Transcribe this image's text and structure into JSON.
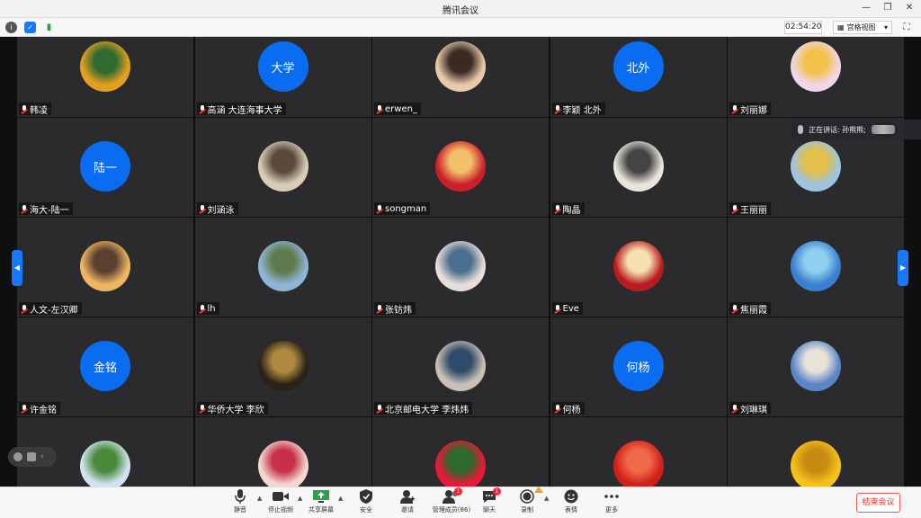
{
  "window": {
    "title": "腾讯会议"
  },
  "statusbar": {
    "timer": "02:54:20",
    "view_mode": "宫格视图"
  },
  "speaking": {
    "label": "正在讲话: 孙熊熊;"
  },
  "participants": [
    {
      "name": "韩凌",
      "avatar_type": "photo",
      "avatar_colors": [
        "#e3a020",
        "#2f6a2f"
      ]
    },
    {
      "name": "高涵 大连海事大学",
      "avatar_type": "text",
      "avatar_text": "大学"
    },
    {
      "name": "erwen_",
      "avatar_type": "photo",
      "avatar_colors": [
        "#e8c9a9",
        "#3a2a22"
      ]
    },
    {
      "name": "李颖 北外",
      "avatar_type": "text",
      "avatar_text": "北外"
    },
    {
      "name": "刘丽娜",
      "avatar_type": "photo",
      "avatar_colors": [
        "#f0d6e8",
        "#f2c14a"
      ]
    },
    {
      "name": "海大-陆一",
      "avatar_type": "text",
      "avatar_text": "陆一"
    },
    {
      "name": "刘涵泳",
      "avatar_type": "photo",
      "avatar_colors": [
        "#d9cdb8",
        "#5a4a3a"
      ]
    },
    {
      "name": "songman",
      "avatar_type": "photo",
      "avatar_colors": [
        "#c9202a",
        "#f2c06a"
      ]
    },
    {
      "name": "陶晶",
      "avatar_type": "photo",
      "avatar_colors": [
        "#e9e5dc",
        "#444444"
      ]
    },
    {
      "name": "王丽丽",
      "avatar_type": "photo",
      "avatar_colors": [
        "#9ec4e0",
        "#e2c04a"
      ]
    },
    {
      "name": "人文-左汉卿",
      "avatar_type": "photo",
      "avatar_colors": [
        "#f0b560",
        "#5a4030"
      ]
    },
    {
      "name": "lh",
      "avatar_type": "photo",
      "avatar_colors": [
        "#8fb5d6",
        "#5d7a4c"
      ]
    },
    {
      "name": "张钫炜",
      "avatar_type": "photo",
      "avatar_colors": [
        "#e8ddd8",
        "#4a6f8f"
      ]
    },
    {
      "name": "Eve",
      "avatar_type": "photo",
      "avatar_colors": [
        "#b81c22",
        "#f5e0b0"
      ]
    },
    {
      "name": "焦丽霞",
      "avatar_type": "photo",
      "avatar_colors": [
        "#3a7fd0",
        "#8fd0f0"
      ]
    },
    {
      "name": "许金铭",
      "avatar_type": "text",
      "avatar_text": "金铭"
    },
    {
      "name": "华侨大学 李欣",
      "avatar_type": "photo",
      "avatar_colors": [
        "#2a2218",
        "#b08a40"
      ]
    },
    {
      "name": "北京邮电大学 李炜炜",
      "avatar_type": "photo",
      "avatar_colors": [
        "#c8c0b5",
        "#2f4a6a"
      ]
    },
    {
      "name": "何杨",
      "avatar_type": "text",
      "avatar_text": "何杨"
    },
    {
      "name": "刘琳琪",
      "avatar_type": "photo",
      "avatar_colors": [
        "#5a86c8",
        "#e8e2d8"
      ]
    },
    {
      "name": "",
      "avatar_type": "photo",
      "avatar_colors": [
        "#cfe3f2",
        "#4a8a3a"
      ]
    },
    {
      "name": "",
      "avatar_type": "photo",
      "avatar_colors": [
        "#f2d8d0",
        "#c8304a"
      ]
    },
    {
      "name": "",
      "avatar_type": "photo",
      "avatar_colors": [
        "#e81838",
        "#2d6a2d"
      ]
    },
    {
      "name": "",
      "avatar_type": "photo",
      "avatar_colors": [
        "#d02018",
        "#f06a4a"
      ]
    },
    {
      "name": "",
      "avatar_type": "photo",
      "avatar_colors": [
        "#f5c21a",
        "#c88a10"
      ]
    }
  ],
  "toolbar": {
    "mute": "静音",
    "stop_video": "停止视频",
    "share_screen": "共享屏幕",
    "security": "安全",
    "invite": "邀请",
    "manage_members": "管理成员(86)",
    "members_badge": "1",
    "chat": "聊天",
    "chat_badge": "1",
    "record": "录制",
    "emoji": "表情",
    "more": "更多",
    "end_meeting": "结束会议"
  },
  "colors": {
    "accent": "#1677ff",
    "end_red": "#e33333",
    "avatar_blue": "#0a6cf0"
  }
}
